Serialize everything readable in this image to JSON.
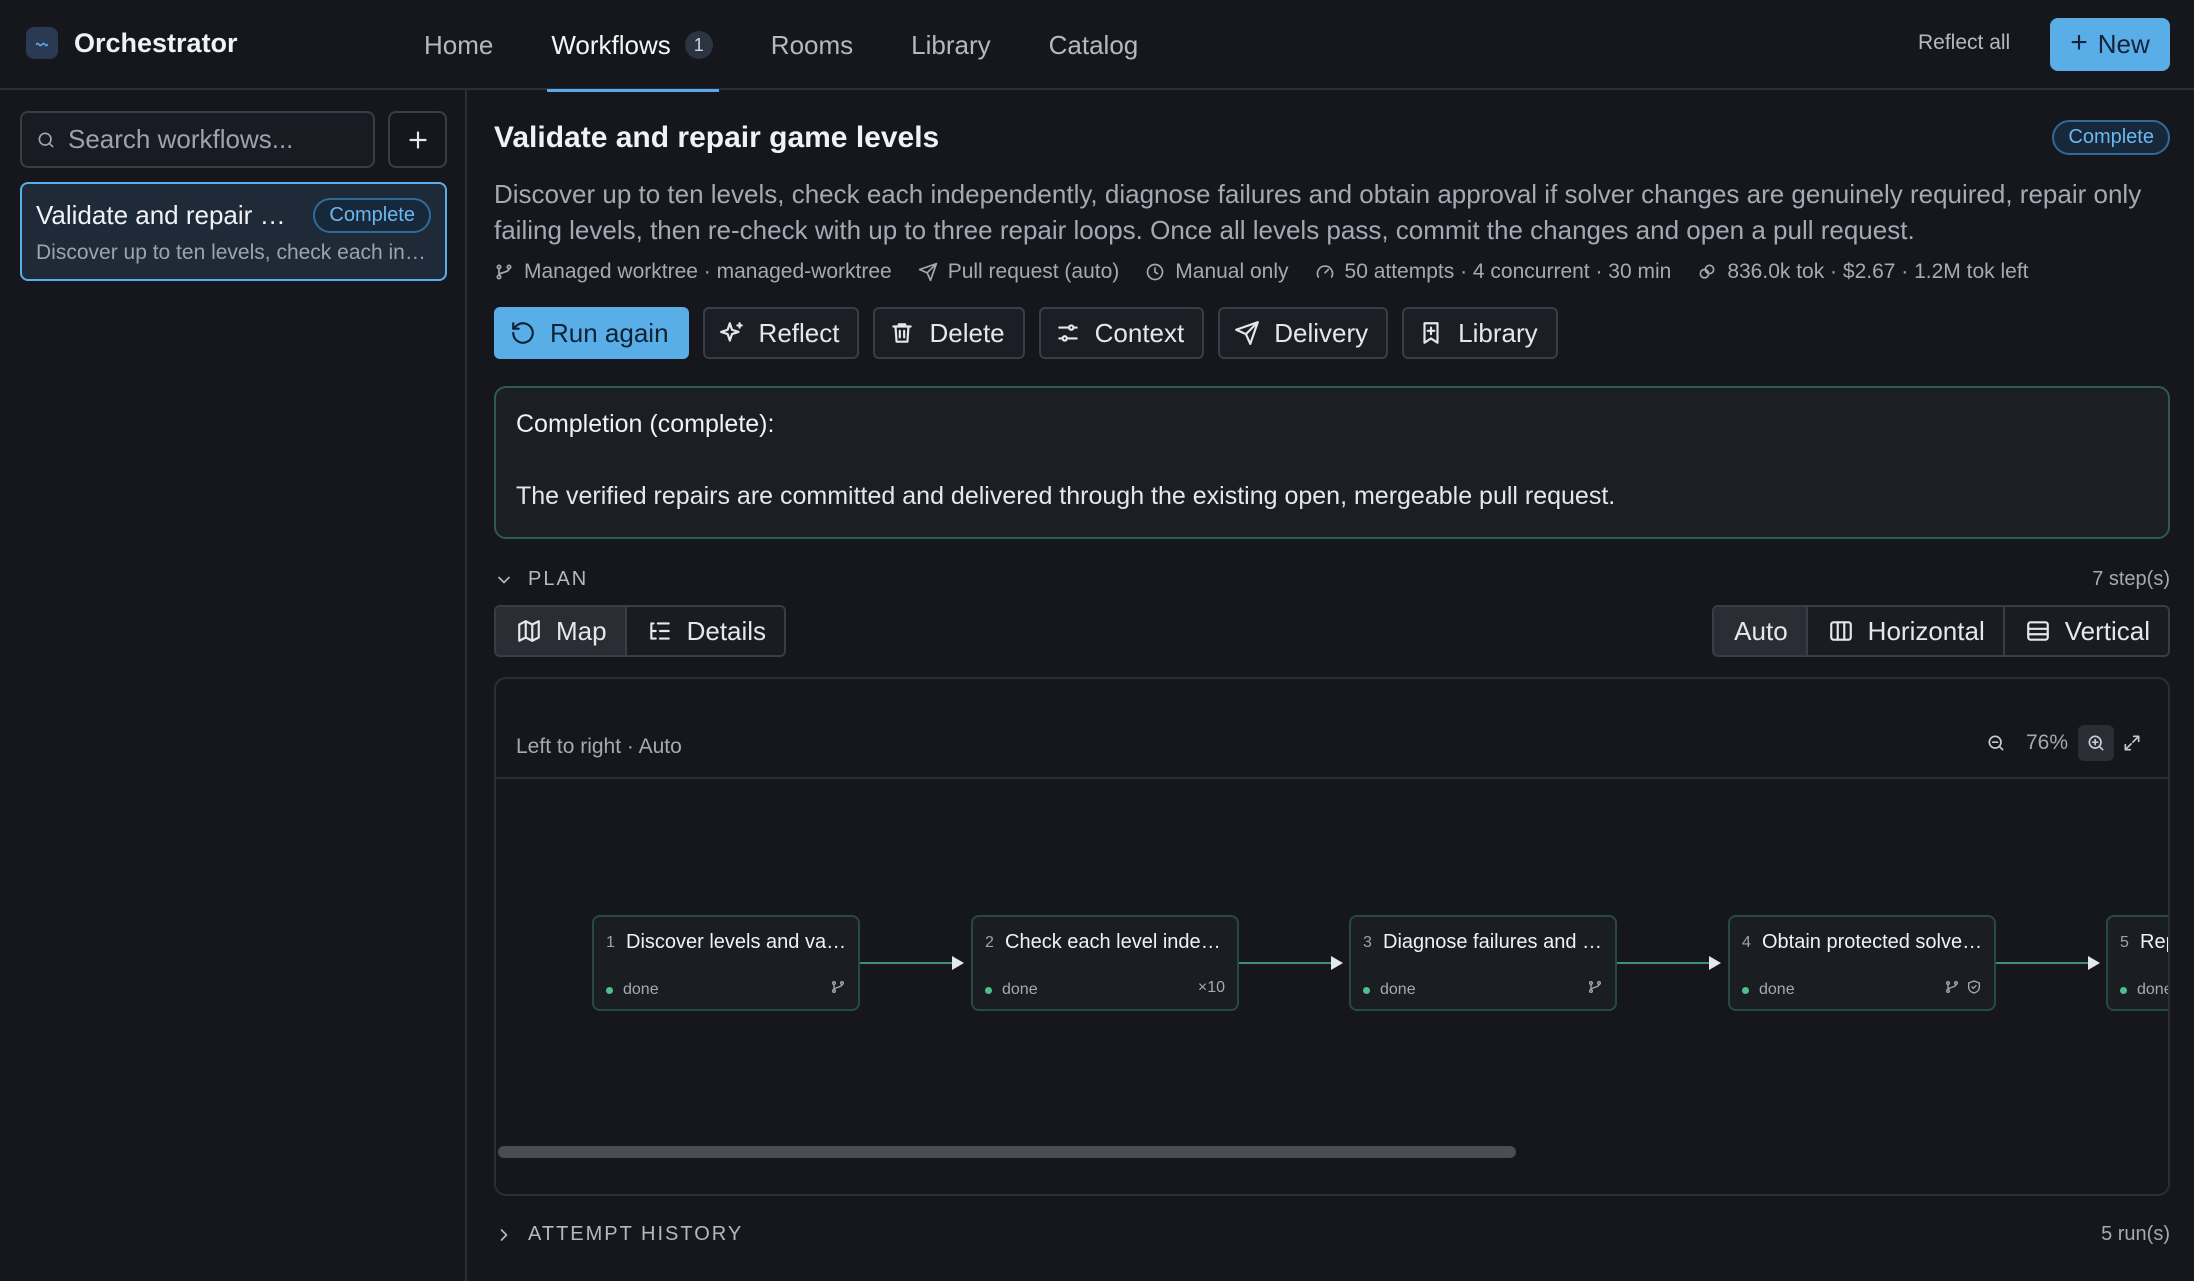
{
  "brand": {
    "name": "Orchestrator",
    "accent": "#5aaee8"
  },
  "nav": {
    "tabs": [
      {
        "label": "Home"
      },
      {
        "label": "Workflows",
        "count": "1"
      },
      {
        "label": "Rooms"
      },
      {
        "label": "Library"
      },
      {
        "label": "Catalog"
      }
    ],
    "reflect_all": "Reflect all",
    "new_label": "New"
  },
  "sidebar": {
    "search_placeholder": "Search workflows...",
    "workflows": [
      {
        "title": "Validate and repair game levels",
        "status": "Complete",
        "description": "Discover up to ten levels, check each independently, diagnose failures and obtain approval if solver changes are genuinely required, repair only failing levels, then re-check with up to three repair loops."
      }
    ]
  },
  "workflow": {
    "title": "Validate and repair game levels",
    "status": "Complete",
    "description": "Discover up to ten levels, check each independently, diagnose failures and obtain approval if solver changes are genuinely required, repair only failing levels, then re-check with up to three repair loops. Once all levels pass, commit the changes and open a pull request.",
    "meta": {
      "worktree": "Managed worktree · managed-worktree",
      "delivery": "Pull request (auto)",
      "schedule": "Manual only",
      "limits": "50 attempts · 4 concurrent · 30 min",
      "usage": "836.0k tok · $2.67 · 1.2M tok left"
    },
    "actions": {
      "run_again": "Run again",
      "reflect": "Reflect",
      "delete": "Delete",
      "context": "Context",
      "delivery": "Delivery",
      "library": "Library"
    },
    "completion": {
      "heading": "Completion (complete):",
      "body": "The verified repairs are committed and delivered through the existing open, mergeable pull request."
    }
  },
  "plan": {
    "label": "PLAN",
    "steps_count": "7 step(s)",
    "view_tabs": {
      "map": "Map",
      "details": "Details"
    },
    "layout_tabs": {
      "auto": "Auto",
      "horizontal": "Horizontal",
      "vertical": "Vertical"
    },
    "canvas_caption": "Left to right · Auto",
    "zoom": "76%",
    "nodes": [
      {
        "num": "1",
        "title": "Discover levels and validate inputs",
        "status": "done",
        "icons": [
          "branch-icon"
        ]
      },
      {
        "num": "2",
        "title": "Check each level independently",
        "status": "done",
        "extra": "×10"
      },
      {
        "num": "3",
        "title": "Diagnose failures and propose fixes",
        "status": "done",
        "icons": [
          "branch-icon"
        ]
      },
      {
        "num": "4",
        "title": "Obtain protected solver approval",
        "status": "done",
        "icons": [
          "branch-icon",
          "shield-icon"
        ]
      },
      {
        "num": "5",
        "title": "Repair failing levels",
        "status": "done"
      }
    ],
    "status_color": "#4fbf8f"
  },
  "history": {
    "label": "ATTEMPT HISTORY",
    "runs_count": "5 run(s)"
  }
}
